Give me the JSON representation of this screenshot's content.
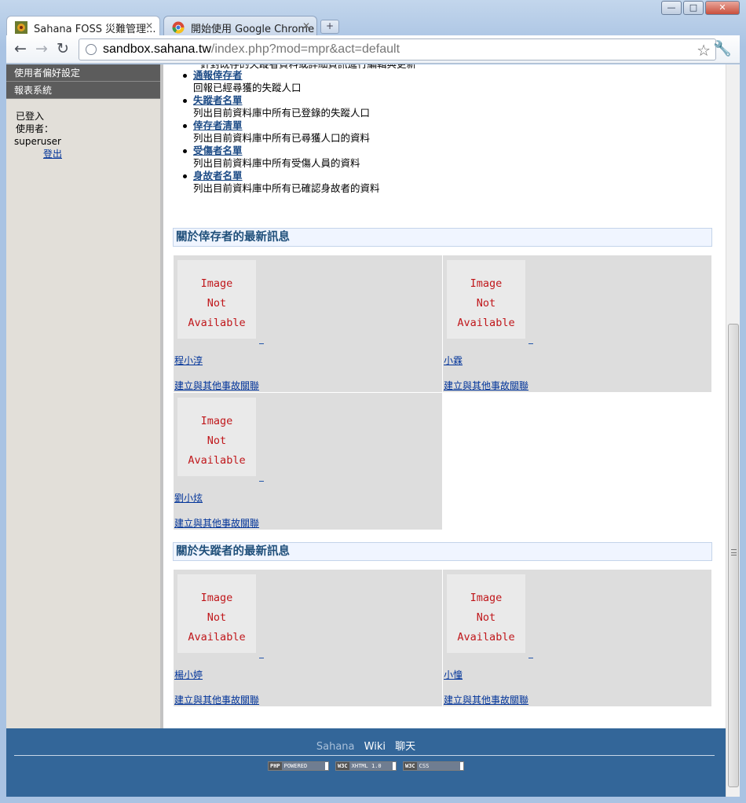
{
  "window": {
    "minimize_glyph": "—",
    "maximize_glyph": "□",
    "close_glyph": "✕"
  },
  "tabs": [
    {
      "title": "Sahana FOSS 災難管理...",
      "active": true
    },
    {
      "title": "開始使用 Google Chrome",
      "active": false
    }
  ],
  "toolbar": {
    "url_host": "sandbox.sahana.tw",
    "url_path": "/index.php?mod=mpr&act=default"
  },
  "sidebar": {
    "menu_items": [
      "使用者偏好設定",
      "報表系統"
    ],
    "login_status": "已登入",
    "user_label": "使用者：",
    "username": "superuser",
    "logout": "登出"
  },
  "modules": {
    "cut_text": "針對既存的失蹤者資料或詳細資訊進行編輯與更新",
    "items": [
      {
        "title": "通報倖存者",
        "desc": "回報已經尋獲的失蹤人口"
      },
      {
        "title": "失蹤者名單",
        "desc": "列出目前資料庫中所有已登錄的失蹤人口"
      },
      {
        "title": "倖存者清單",
        "desc": "列出目前資料庫中所有已尋獲人口的資料"
      },
      {
        "title": "受傷者名單",
        "desc": "列出目前資料庫中所有受傷人員的資料"
      },
      {
        "title": "身故者名單",
        "desc": "列出目前資料庫中所有已確認身故者的資料"
      }
    ]
  },
  "placeholder": {
    "line1": "Image",
    "line2": "Not",
    "line3": "Available"
  },
  "found_section": {
    "title": "關於倖存者的最新訊息",
    "people": [
      {
        "name": "程小淳",
        "link": "建立與其他事故關聯"
      },
      {
        "name": "小霖",
        "link": "建立與其他事故關聯"
      },
      {
        "name": "劉小炫",
        "link": "建立與其他事故關聯"
      }
    ]
  },
  "missing_section": {
    "title": "關於失蹤者的最新訊息",
    "people": [
      {
        "name": "楊小婷",
        "link": "建立與其他事故關聯"
      },
      {
        "name": "小憧",
        "link": "建立與其他事故關聯"
      }
    ]
  },
  "footer": {
    "sahana": "Sahana",
    "wiki": "Wiki",
    "chat": "聊天",
    "badges": [
      {
        "tag": "PHP",
        "text": "POWERED"
      },
      {
        "tag": "W3C",
        "text": "XHTML 1.0"
      },
      {
        "tag": "W3C",
        "text": "CSS"
      }
    ]
  },
  "colors": {
    "footer_bg": "#336699",
    "section_title": "#1f4f7a",
    "placeholder_text": "#c0171b",
    "link": "#003399"
  }
}
